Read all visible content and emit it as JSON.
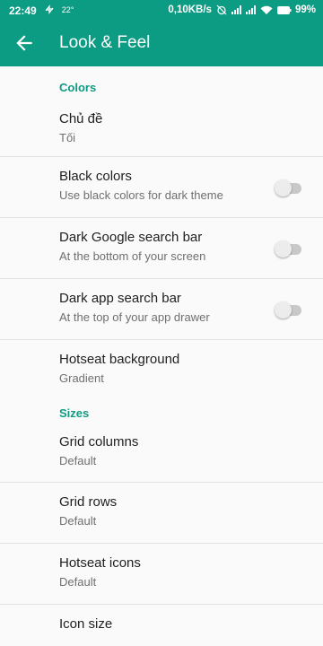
{
  "status_bar": {
    "time": "22:49",
    "temperature": "22°",
    "net_speed": "0,10KB/s",
    "battery": "99%",
    "icons": [
      "sync-icon",
      "alarm-off-icon",
      "signal-icon",
      "signal-icon",
      "wifi-icon",
      "battery-icon"
    ]
  },
  "app_bar": {
    "title": "Look & Feel",
    "back_icon": "arrow-back-icon"
  },
  "sections": {
    "colors": {
      "header": "Colors",
      "items": [
        {
          "title": "Chủ đề",
          "summary": "Tối"
        },
        {
          "title": "Black colors",
          "summary": "Use black colors for dark theme",
          "switch": "off"
        },
        {
          "title": "Dark Google search bar",
          "summary": "At the bottom of your screen",
          "switch": "off"
        },
        {
          "title": "Dark app search bar",
          "summary": "At the top of your app drawer",
          "switch": "off"
        },
        {
          "title": "Hotseat background",
          "summary": "Gradient"
        }
      ]
    },
    "sizes": {
      "header": "Sizes",
      "items": [
        {
          "title": "Grid columns",
          "summary": "Default"
        },
        {
          "title": "Grid rows",
          "summary": "Default"
        },
        {
          "title": "Hotseat icons",
          "summary": "Default"
        },
        {
          "title": "Icon size",
          "summary": ""
        }
      ]
    }
  },
  "colors": {
    "accent": "#0c9c83",
    "background": "#fafafa",
    "switch_track_off": "#c9c9c9",
    "switch_thumb_off": "#ececec"
  }
}
